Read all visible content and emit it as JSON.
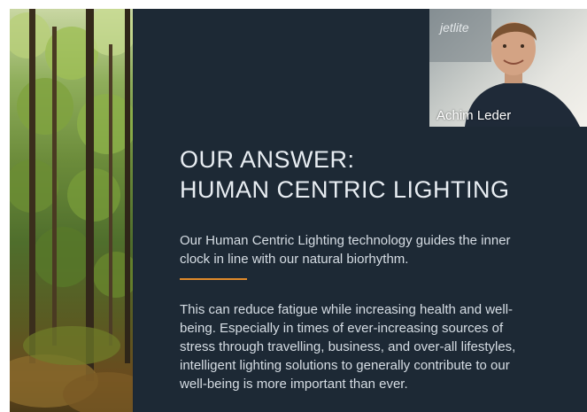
{
  "slide": {
    "title_line1": "OUR ANSWER:",
    "title_line2": "HUMAN CENTRIC LIGHTING",
    "intro_line1": "Our Human Centric Lighting technology guides the inner",
    "intro_line2": "clock in line with our natural biorhythm.",
    "body_line1": "This can reduce fatigue while increasing health and well-",
    "body_line2": "being. Especially in times of ever-increasing sources of",
    "body_line3": "stress through travelling, business, and over-all lifestyles,",
    "body_line4": "intelligent lighting solutions to generally contribute to our",
    "body_line5": "well-being is more important than ever."
  },
  "participant": {
    "name": "Achim Leder",
    "background_sign": "jetlite"
  },
  "colors": {
    "slide_background": "#1d2935",
    "accent": "#e08a2a",
    "text": "#d6dde4"
  }
}
